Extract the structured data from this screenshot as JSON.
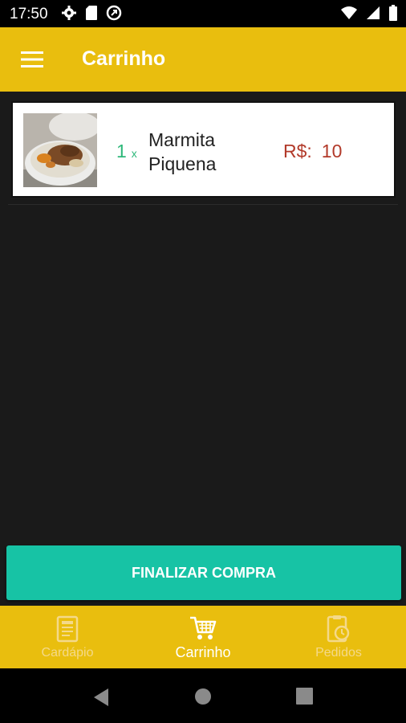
{
  "status_bar": {
    "time": "17:50",
    "icons_left": [
      "gear-icon",
      "sd-card-icon",
      "data-saver-icon"
    ],
    "icons_right": [
      "wifi-icon",
      "signal-icon",
      "battery-icon"
    ]
  },
  "app_bar": {
    "title": "Carrinho",
    "menu_icon": "menu-icon",
    "color": "#e9be0e"
  },
  "cart": {
    "items": [
      {
        "image": "marmita-photo",
        "quantity": "1",
        "quantity_sep": "x",
        "name": "Marmita Piquena",
        "currency": "R$:",
        "price": "10"
      }
    ]
  },
  "checkout": {
    "label": "FINALIZAR COMPRA",
    "color": "#17c3a5"
  },
  "bottom_nav": {
    "items": [
      {
        "label": "Cardápio",
        "icon": "menu-card-icon",
        "active": false
      },
      {
        "label": "Carrinho",
        "icon": "cart-icon",
        "active": true
      },
      {
        "label": "Pedidos",
        "icon": "orders-icon",
        "active": false
      }
    ]
  },
  "system_nav": {
    "buttons": [
      "back-icon",
      "home-icon",
      "recents-icon"
    ]
  }
}
